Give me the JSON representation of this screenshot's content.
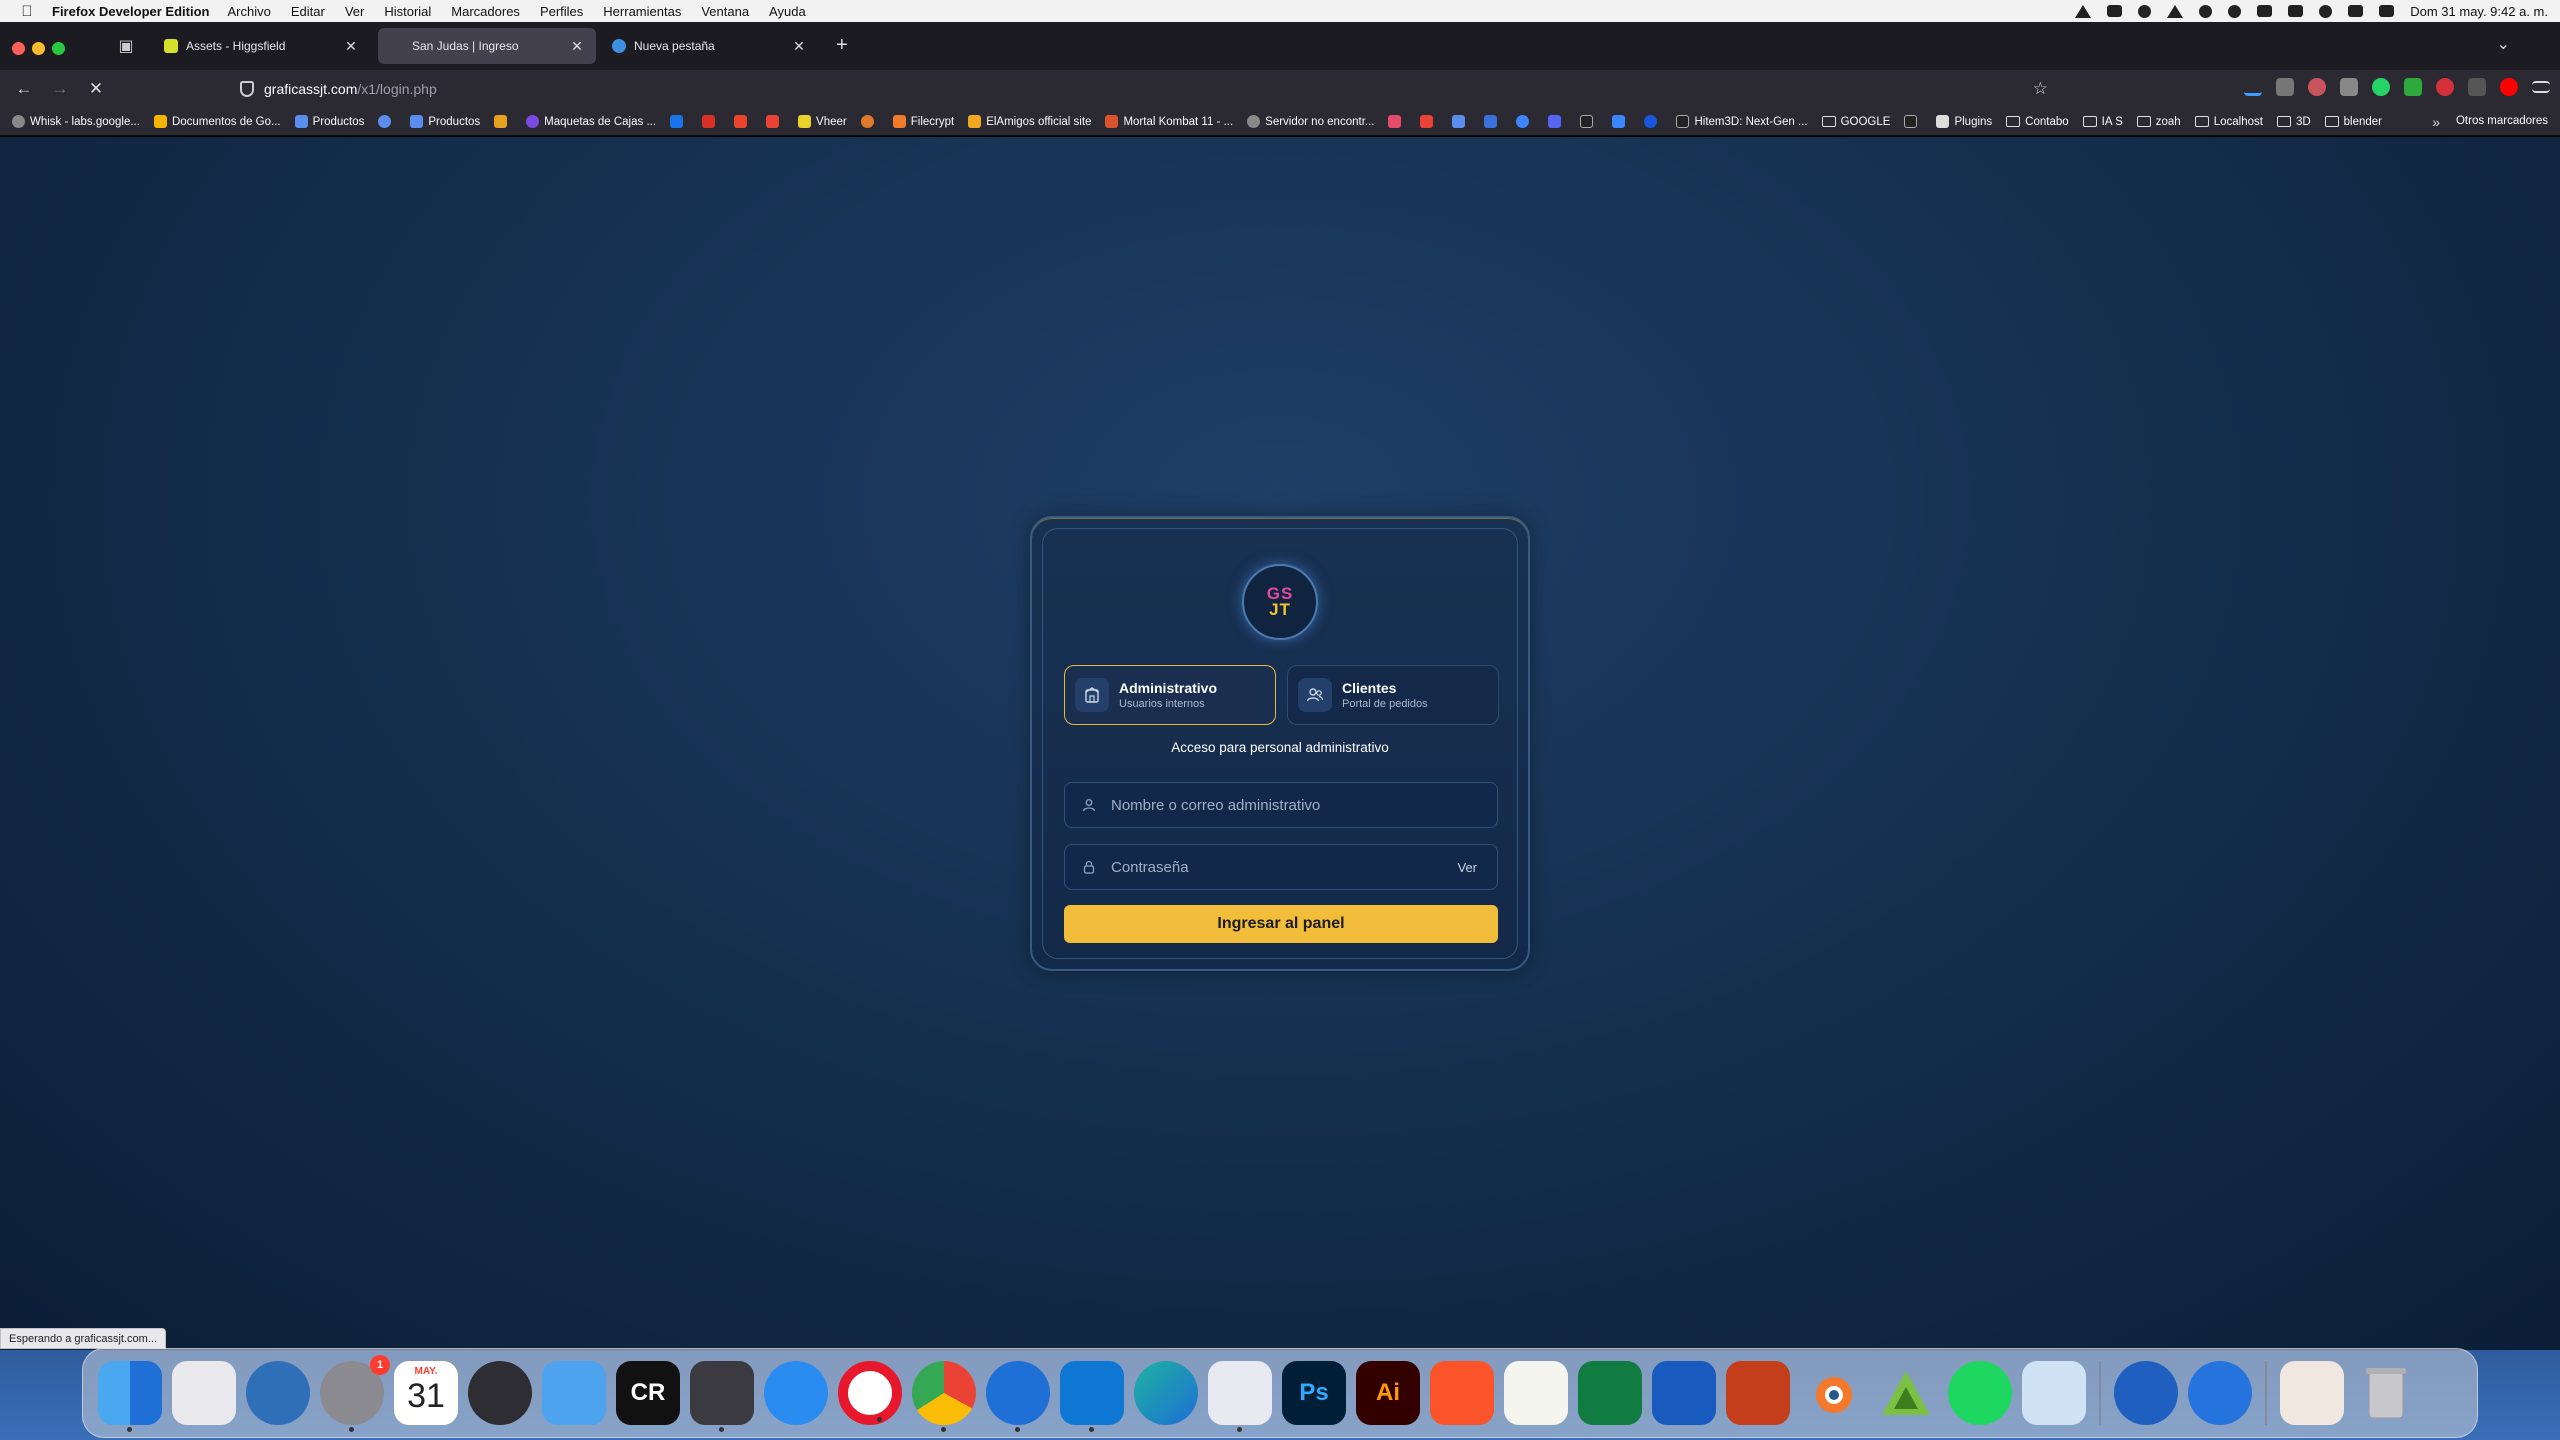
{
  "menubar": {
    "app_name": "Firefox Developer Edition",
    "menus": [
      "Archivo",
      "Editar",
      "Ver",
      "Historial",
      "Marcadores",
      "Perfiles",
      "Herramientas",
      "Ventana",
      "Ayuda"
    ],
    "clock": "Dom 31 may.  9:42 a. m."
  },
  "tabs": [
    {
      "title": "Assets - Higgsfield",
      "favicon_color": "#d4e02a"
    },
    {
      "title": "San Judas | Ingreso",
      "favicon_color": "#3d6fb0"
    },
    {
      "title": "Nueva pestaña",
      "favicon_color": "#3d8fe0"
    }
  ],
  "url": {
    "host": "graficassjt.com",
    "path": "/x1/login.php"
  },
  "bookmarks": [
    {
      "label": "Whisk - labs.google...",
      "color": "#888"
    },
    {
      "label": "Documentos de Go...",
      "color": "#f4b400"
    },
    {
      "label": "Productos",
      "color": "#5b8def"
    },
    {
      "label": "Productos",
      "color": "#5b8def"
    },
    {
      "label": "Maquetas de Cajas ...",
      "color": "#7b4ae2"
    },
    {
      "label": "Vheer",
      "color": "#e8d22a"
    },
    {
      "label": "Filecrypt",
      "color": "#f07b2a"
    },
    {
      "label": "ElAmigos official site",
      "color": "#f0a81f"
    },
    {
      "label": "Mortal Kombat 11 - ...",
      "color": "#d9532c"
    },
    {
      "label": "Servidor no encontr...",
      "color": "#888"
    },
    {
      "label": "Hitem3D: Next-Gen ...",
      "color": "#222"
    }
  ],
  "bookmark_folders": [
    "GOOGLE",
    "Plugins",
    "Contabo",
    "IA S",
    "zoah",
    "Localhost",
    "3D",
    "blender"
  ],
  "other_bookmarks": "Otros marcadores",
  "login": {
    "logo_lines": [
      "GS",
      "JT"
    ],
    "roles": [
      {
        "title": "Administrativo",
        "subtitle": "Usuarios internos",
        "icon": "building-icon"
      },
      {
        "title": "Clientes",
        "subtitle": "Portal de pedidos",
        "icon": "users-icon"
      }
    ],
    "access_text": "Acceso para personal administrativo",
    "user_placeholder": "Nombre o correo administrativo",
    "pass_placeholder": "Contraseña",
    "show_password_label": "Ver",
    "submit_label": "Ingresar al panel",
    "accent_color": "#f2bd3b"
  },
  "status_bar": "Esperando a graficassjt.com...",
  "dock": {
    "calendar_month": "MAY.",
    "calendar_day": "31",
    "settings_badge": "1",
    "photoshop_label": "Ps",
    "illustrator_label": "Ai",
    "capcut_label": "CR"
  }
}
